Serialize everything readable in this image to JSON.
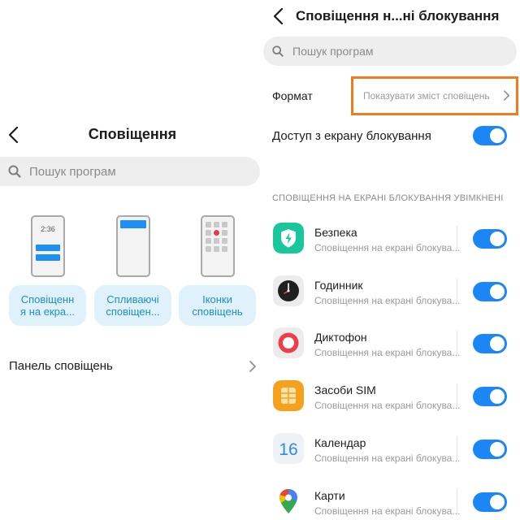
{
  "left": {
    "title": "Сповіщення",
    "search_placeholder": "Пошук програм",
    "lock_time": "2:36",
    "options": [
      {
        "label": "Сповіщенн\nя на екра..."
      },
      {
        "label": "Спливаючі\nсповіщен..."
      },
      {
        "label": "Іконки\nсповіщень"
      }
    ],
    "panel_row_label": "Панель сповіщень"
  },
  "right": {
    "title": "Сповіщення н...ні блокування",
    "search_placeholder": "Пошук програм",
    "format_label": "Формат",
    "format_value": "Показувати зміст сповіщень",
    "lock_access_label": "Доступ з екрану блокування",
    "lock_access_on": true,
    "section_header": "СПОВІЩЕННЯ НА ЕКРАНІ БЛОКУВАННЯ УВІМКНЕНІ",
    "apps": [
      {
        "name": "Безпека",
        "subtitle": "Сповіщення на екрані блокува...",
        "icon": "security-shield-icon",
        "enabled": true
      },
      {
        "name": "Годинник",
        "subtitle": "Сповіщення на екрані блокува...",
        "icon": "clock-icon",
        "enabled": true
      },
      {
        "name": "Диктофон",
        "subtitle": "Сповіщення на екрані блокува...",
        "icon": "recorder-icon",
        "enabled": true
      },
      {
        "name": "Засоби SIM",
        "subtitle": "Сповіщення на екрані блокува...",
        "icon": "sim-card-icon",
        "enabled": true
      },
      {
        "name": "Календар",
        "subtitle": "Сповіщення на екрані блокува...",
        "icon": "calendar-icon",
        "icon_text": "16",
        "enabled": true
      },
      {
        "name": "Карти",
        "subtitle": "Сповіщення на екрані блокува...",
        "icon": "maps-pin-icon",
        "enabled": true
      }
    ]
  },
  "colors": {
    "accent": "#1b86f5",
    "pill_bg": "#dff2fb",
    "pill_text": "#1f8ec4",
    "highlight": "#f07c1f"
  }
}
